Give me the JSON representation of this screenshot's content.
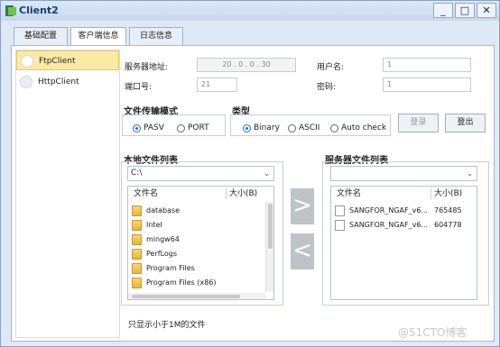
{
  "window": {
    "title": "Client2",
    "min": "_",
    "max": "□",
    "close": "✕"
  },
  "tabs": [
    "基础配置",
    "客户端信息",
    "日志信息"
  ],
  "sidebar": {
    "items": [
      "FtpClient",
      "HttpClient"
    ]
  },
  "form": {
    "server_addr_label": "服务器地址:",
    "server_addr_value": "20 . 0 . 0 . 30",
    "port_label": "端口号:",
    "port_value": "21",
    "username_label": "用户名:",
    "username_value": "1",
    "password_label": "密码:",
    "password_value": "1"
  },
  "transfer_mode": {
    "title": "文件传输模式",
    "options": [
      "PASV",
      "PORT"
    ],
    "selected": "PASV"
  },
  "type_group": {
    "title": "类型",
    "options": [
      "Binary",
      "ASCII",
      "Auto check"
    ],
    "selected": "Binary"
  },
  "buttons": {
    "login": "登录",
    "logout": "登出"
  },
  "local": {
    "title": "本地文件列表",
    "path": "C:\\",
    "col_name": "文件名",
    "col_size": "大小(B)",
    "rows": [
      "database",
      "Intel",
      "mingw64",
      "PerfLogs",
      "Program Files",
      "Program Files (x86)"
    ]
  },
  "server": {
    "title": "服务器文件列表",
    "path": "",
    "col_name": "文件名",
    "col_size": "大小(B)",
    "rows": [
      {
        "name": "SANGFOR_NGAF_v6...",
        "size": "765485"
      },
      {
        "name": "SANGFOR_NGAF_v6...",
        "size": "604778"
      }
    ]
  },
  "transfer": {
    "upload_icon": ">",
    "download_icon": "<"
  },
  "footer_text": "只显示小于1M的文件",
  "watermark": "@51CTO博客",
  "colors": {
    "accent": "#1d6fd1",
    "selected_bg": "#fbeaa4"
  }
}
